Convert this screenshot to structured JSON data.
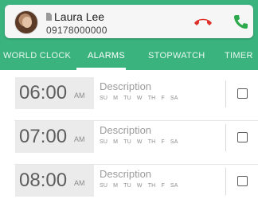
{
  "call": {
    "caller_name": "Laura Lee",
    "caller_number": "09178000000",
    "icons": {
      "avatar": "contact-photo",
      "sim": "sim-card-icon",
      "hangup": "hang-up-phone-icon",
      "answer": "answer-phone-icon"
    },
    "colors": {
      "hangup": "#e0302a",
      "answer": "#2daa4c"
    }
  },
  "tabs": [
    {
      "label": "WORLD CLOCK",
      "active": false
    },
    {
      "label": "ALARMS",
      "active": true
    },
    {
      "label": "STOPWATCH",
      "active": false
    },
    {
      "label": "TIMER",
      "active": false
    }
  ],
  "colors": {
    "accent": "#3ab37e"
  },
  "alarms": [
    {
      "time": "06:00",
      "ampm": "AM",
      "description": "Description",
      "days": [
        "SU",
        "M",
        "TU",
        "W",
        "TH",
        "F",
        "SA"
      ],
      "checked": false
    },
    {
      "time": "07:00",
      "ampm": "AM",
      "description": "Description",
      "days": [
        "SU",
        "M",
        "TU",
        "W",
        "TH",
        "F",
        "SA"
      ],
      "checked": false
    },
    {
      "time": "08:00",
      "ampm": "AM",
      "description": "Description",
      "days": [
        "SU",
        "M",
        "TU",
        "W",
        "TH",
        "F",
        "SA"
      ],
      "checked": false
    }
  ]
}
